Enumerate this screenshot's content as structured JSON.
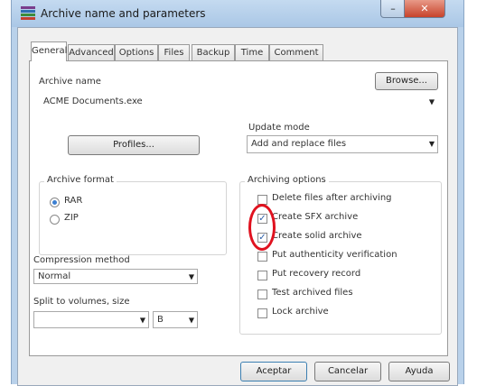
{
  "window": {
    "title": "Archive name and parameters"
  },
  "tabs": [
    {
      "label": "General",
      "active": true
    },
    {
      "label": "Advanced"
    },
    {
      "label": "Options"
    },
    {
      "label": "Files"
    },
    {
      "label": "Backup"
    },
    {
      "label": "Time"
    },
    {
      "label": "Comment"
    }
  ],
  "general": {
    "archive_name_label": "Archive name",
    "browse_label": "Browse...",
    "archive_name_value": "ACME Documents.exe",
    "profiles_label": "Profiles...",
    "update_mode_label": "Update mode",
    "update_mode_value": "Add and replace files",
    "archive_format": {
      "title": "Archive format",
      "options": [
        {
          "label": "RAR",
          "selected": true
        },
        {
          "label": "ZIP",
          "selected": false
        }
      ]
    },
    "compression_method_label": "Compression method",
    "compression_method_value": "Normal",
    "split_label": "Split to volumes, size",
    "split_value": "",
    "split_unit": "B",
    "archiving_options": {
      "title": "Archiving options",
      "items": [
        {
          "label": "Delete files after archiving",
          "checked": false
        },
        {
          "label": "Create SFX archive",
          "checked": true
        },
        {
          "label": "Create solid archive",
          "checked": true
        },
        {
          "label": "Put authenticity verification",
          "checked": false
        },
        {
          "label": "Put recovery record",
          "checked": false
        },
        {
          "label": "Test archived files",
          "checked": false
        },
        {
          "label": "Lock archive",
          "checked": false
        }
      ]
    }
  },
  "footer": {
    "accept_label": "Aceptar",
    "cancel_label": "Cancelar",
    "help_label": "Ayuda"
  },
  "colors": {
    "annotation": "#e0121f",
    "titlebar": "#b9d1ea",
    "close": "#c7432b"
  }
}
